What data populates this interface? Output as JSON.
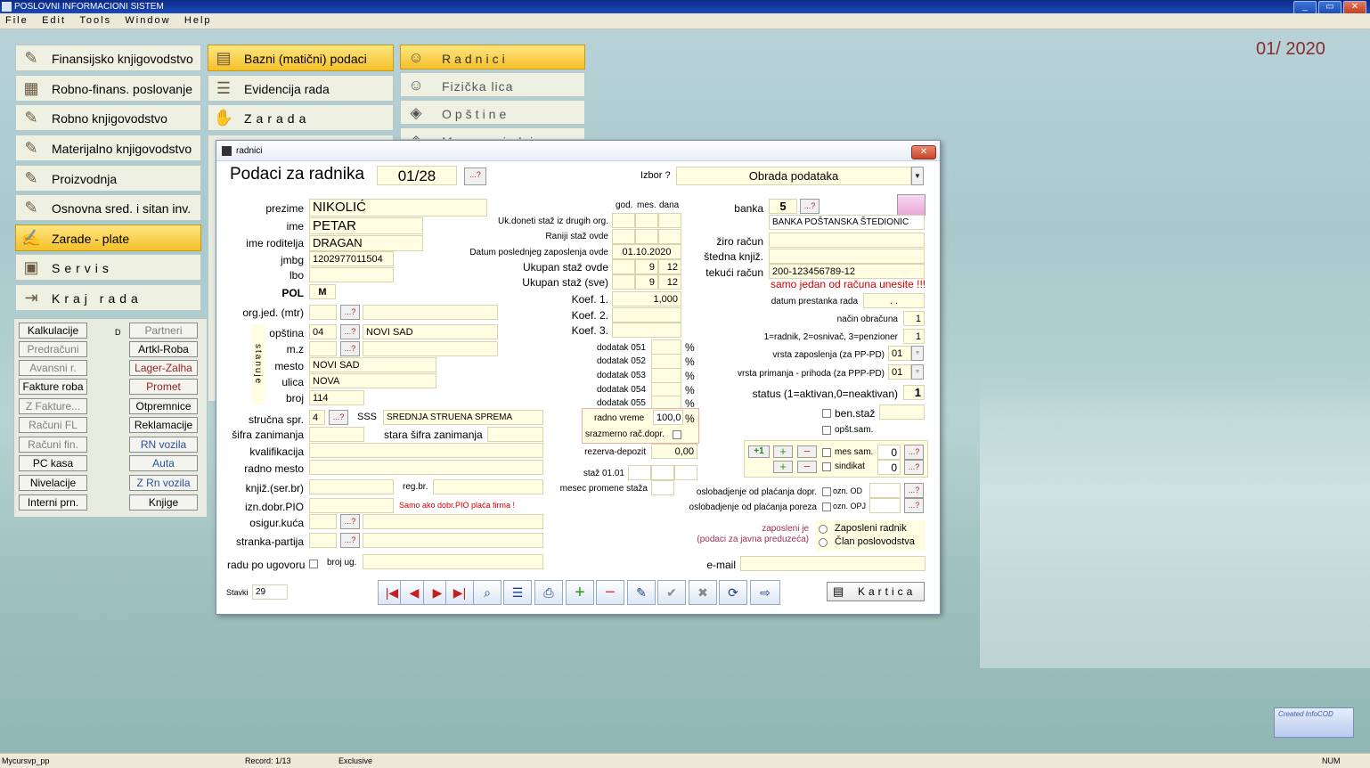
{
  "app": {
    "title": "POSLOVNI INFORMACIONI SISTEM",
    "period": "01/ 2020"
  },
  "menu": [
    "File",
    "Edit",
    "Tools",
    "Window",
    "Help"
  ],
  "window_buttons": {
    "min": "_",
    "max": "▭",
    "close": "✕"
  },
  "main_modules": [
    {
      "label": "Finansijsko knjigovodstvo",
      "icon": "ledger-icon"
    },
    {
      "label": "Robno-finans. poslovanje",
      "icon": "cash-register-icon"
    },
    {
      "label": "Robno knjigovodstvo",
      "icon": "ledger-icon"
    },
    {
      "label": "Materijalno knjigovodstvo",
      "icon": "ledger-icon"
    },
    {
      "label": "Proizvodnja",
      "icon": "ledger-icon"
    },
    {
      "label": "Osnovna sred. i sitan inv.",
      "icon": "ledger-icon"
    },
    {
      "label": "Zarade - plate",
      "icon": "payroll-icon"
    },
    {
      "label": "Servis",
      "icon": "computer-icon"
    },
    {
      "label": "Kraj rada",
      "icon": "exit-icon"
    }
  ],
  "submodules": [
    {
      "label": "Bazni (matični) podaci",
      "icon": "folder-icon"
    },
    {
      "label": "Evidencija rada",
      "icon": "document-icon"
    },
    {
      "label": "Zarada",
      "icon": "money-icon"
    }
  ],
  "subsub": [
    {
      "label": "Radnici",
      "icon": "worker-icon"
    },
    {
      "label": "Fizička lica",
      "icon": "person-icon"
    },
    {
      "label": "Opštine",
      "icon": "map-icon"
    },
    {
      "label": "Mesne zajednice",
      "icon": "map-icon"
    }
  ],
  "shortcuts_left": [
    "Kalkulacije",
    "Predračuni",
    "Avansni r.",
    "Fakture roba",
    "Z Fakture...",
    "Računi FL",
    "Računi fin.",
    "PC kasa",
    "Nivelacije",
    "Interni prn."
  ],
  "shortcuts_right": [
    "Partneri",
    "Artkl-Roba",
    "Lager-Zalha",
    "Promet",
    "Otpremnice",
    "Reklamacije",
    "RN vozila",
    "Auta",
    "Z Rn vozila",
    "Knjige"
  ],
  "shortcut_letter": "D",
  "dialog": {
    "window_title": "radnici",
    "heading": "Podaci za radnika",
    "record_no": "01/28",
    "izbor_label": "Izbor ?",
    "izbor_value": "Obrada podataka",
    "q": "...?",
    "left": {
      "prezime_l": "prezime",
      "prezime": "NIKOLIĆ",
      "ime_l": "ime",
      "ime": "PETAR",
      "roditelj_l": "ime roditelja",
      "roditelj": "DRAGAN",
      "jmbg_l": "jmbg",
      "jmbg": "1202977011504",
      "lbo_l": "lbo",
      "lbo": "",
      "pol_l": "POL",
      "pol": "M",
      "orgjed_l": "org.jed. (mtr)",
      "stanuje": "stanuje",
      "opstina_l": "opština",
      "opstina_code": "04",
      "opstina": "NOVI SAD",
      "mz_l": "m.z",
      "mesto_l": "mesto",
      "mesto": "NOVI SAD",
      "ulica_l": "ulica",
      "ulica": "NOVA",
      "broj_l": "broj",
      "broj": "114",
      "struc_l": "stručna spr.",
      "struc_code": "4",
      "struc_short": "SSS",
      "struc": "SREDNJA STRUENA SPREMA",
      "sifra_l": "šifra zanimanja",
      "stara_l": "stara šifra zanimanja",
      "kval_l": "kvalifikacija",
      "rm_l": "radno mesto",
      "knjiz_l": "knjiž.(ser.br)",
      "regbr_l": "reg.br.",
      "pio_l": "izn.dobr.PIO",
      "pio_note": "Samo ako dobr.PIO plaća firma !",
      "osig_l": "osigur.kuća",
      "stranka_l": "stranka-partija",
      "ugovor_l": "radu po ugovoru",
      "brojug_l": "broj ug."
    },
    "mid": {
      "god": "god.",
      "mes": "mes.",
      "dana": "dana",
      "uk_doneti": "Uk.doneti staž iz drugih org.",
      "raniji": "Raniji staž ovde",
      "datum_l": "Datum poslednjeg zaposlenja ovde",
      "datum": "01.10.2020",
      "ukovde_l": "Ukupan staž ovde",
      "ukovde_mes": "9",
      "ukovde_dana": "12",
      "uksve_l": "Ukupan staž (sve)",
      "uksve_mes": "9",
      "uksve_dana": "12",
      "koef1_l": "Koef. 1.",
      "koef1": "1,000",
      "koef2_l": "Koef. 2.",
      "koef3_l": "Koef. 3.",
      "dodaci": [
        "dodatak 051",
        "dodatak 052",
        "dodatak 053",
        "dodatak 054",
        "dodatak 055"
      ],
      "pct": "%",
      "rv_l": "radno vreme",
      "rv": "100,0",
      "srazm_l": "srazmerno rač.dopr.",
      "rez_l": "rezerva-depozit",
      "rez": "0,00",
      "staz_l": "staž 01.01",
      "mesec_l": "mesec promene staža"
    },
    "right": {
      "banka_l": "banka",
      "banka_code": "5",
      "banka": "BANKA POŠTANSKA ŠTEDIONIC",
      "ziro_l": "žiro račun",
      "stedna_l": "štedna knjiž.",
      "tekuci_l": "tekući račun",
      "tekuci": "200-123456789-12",
      "warn": "samo jedan od računa unesite !!!",
      "prest_l": "datum prestanka rada",
      "prest": ". .",
      "nacin_l": "način obračuna",
      "nacin": "1",
      "vrsta_l": "1=radnik, 2=osnivač, 3=penzioner",
      "vrsta": "1",
      "zap_l": "vrsta zaposlenja  (za PP-PD)",
      "zap": "01",
      "prim_l": "vrsta primanja - prihoda (za PPP-PD)",
      "prim": "01",
      "status_l": "status (1=aktivan,0=neaktivan)",
      "status": "1",
      "ben_l": "ben.staž",
      "opst_l": "opšt.sam.",
      "plus1": "+1",
      "messam_l": "mes sam.",
      "messam": "0",
      "sind_l": "sindikat",
      "sind": "0",
      "oslob_dopr_l": "oslobadjenje od plaćanja dopr.",
      "oznod_l": "ozn. OD",
      "oslob_por_l": "oslobadjenje od plaćanja poreza",
      "oznopj_l": "ozn. OPJ",
      "zap_je": "zaposleni je",
      "zap_je2": "(podaci za javna preduzeća)",
      "radio1": "Zaposleni radnik",
      "radio2": "Član poslovodstva",
      "email_l": "e-mail"
    },
    "footer": {
      "stavki_l": "Stavki",
      "stavki": "29",
      "kartica": "Kartica"
    }
  },
  "status": {
    "left": "Mycursvp_pp",
    "record": "Record: 1/13",
    "mode": "Exclusive",
    "num": "NUM"
  },
  "logo": "Created InfoCOD"
}
